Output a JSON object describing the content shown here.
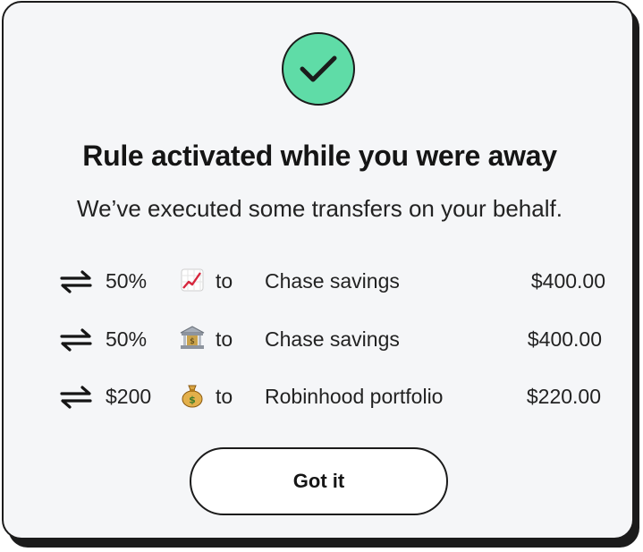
{
  "dialog": {
    "title": "Rule activated while you were away",
    "subtitle": "We’ve executed some transfers on your behalf.",
    "button_label": "Got it",
    "accent_color": "#5fdca7"
  },
  "transfers": [
    {
      "icon": "transfer-arrows-icon",
      "amount_rule": "50%",
      "emoji": "chart-increasing-icon",
      "connector": "to",
      "destination": "Chase savings",
      "amount": "$400.00"
    },
    {
      "icon": "transfer-arrows-icon",
      "amount_rule": "50%",
      "emoji": "bank-icon",
      "connector": "to",
      "destination": "Chase savings",
      "amount": "$400.00"
    },
    {
      "icon": "transfer-arrows-icon",
      "amount_rule": "$200",
      "emoji": "money-bag-icon",
      "connector": "to",
      "destination": "Robinhood portfolio",
      "amount": "$220.00"
    }
  ]
}
